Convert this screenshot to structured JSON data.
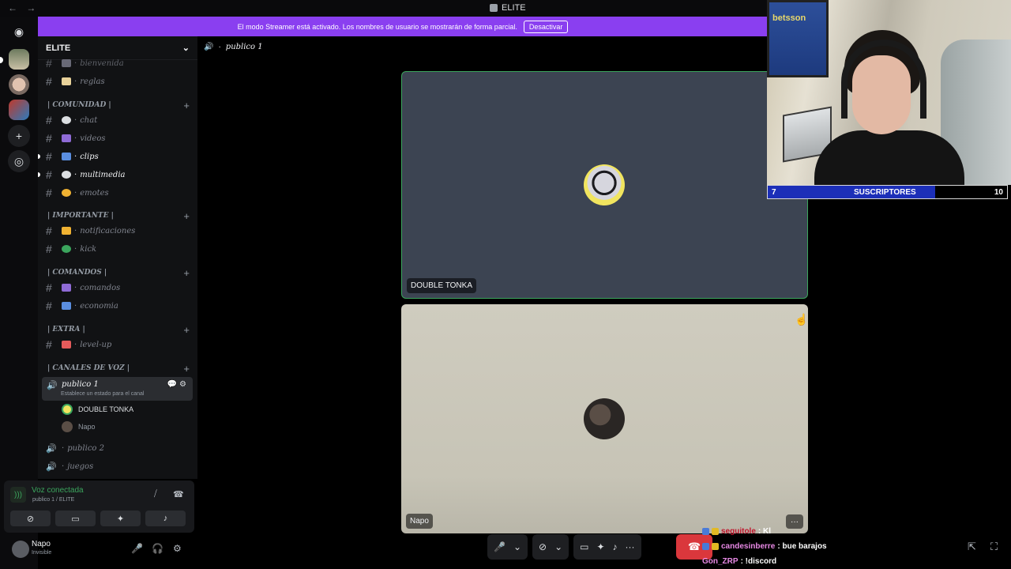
{
  "titlebar": {
    "title": "ELITE",
    "back": "←",
    "forward": "→"
  },
  "banner": {
    "message": "El modo Streamer está activado. Los nombres de usuario se mostrarán de forma parcial.",
    "button": "Desactivar"
  },
  "server": {
    "name": "ELITE"
  },
  "channels": [
    {
      "label": "bienvenida",
      "emoji_color": "#8e8ea0"
    },
    {
      "label": "reglas",
      "emoji_color": "#e8d29a"
    },
    {
      "label": "chat",
      "emoji_color": "#dbdee1"
    },
    {
      "label": "videos",
      "emoji_color": "#8f6bd6"
    },
    {
      "label": "clips",
      "emoji_color": "#5a8ee0"
    },
    {
      "label": "multimedia",
      "emoji_color": "#dbdee1"
    },
    {
      "label": "emotes",
      "emoji_color": "#f0b232"
    },
    {
      "label": "notificaciones",
      "emoji_color": "#f0b232"
    },
    {
      "label": "kick",
      "emoji_color": "#3ba55d"
    },
    {
      "label": "comandos",
      "emoji_color": "#8f6bd6"
    },
    {
      "label": "economia",
      "emoji_color": "#5a8ee0"
    },
    {
      "label": "level-up",
      "emoji_color": "#e55b5b"
    }
  ],
  "categories": [
    {
      "label": "| COMUNIDAD |",
      "plus": "+"
    },
    {
      "label": "| IMPORTANTE |",
      "plus": "+"
    },
    {
      "label": "| COMANDOS |",
      "plus": "+"
    },
    {
      "label": "| EXTRA |",
      "plus": "+"
    },
    {
      "label": "| CANALES DE VOZ |",
      "plus": "+"
    }
  ],
  "voice_channels": {
    "active": {
      "label": "publico 1",
      "status": "Establece un estado para el canal",
      "members": [
        "DOUBLE TONKA",
        "Napo"
      ]
    },
    "others": [
      "publico 2",
      "juegos"
    ]
  },
  "voice_panel": {
    "connected": "Voz conectada",
    "location": "publico 1 / ELITE"
  },
  "user": {
    "name": "Napo",
    "status": "Invisible"
  },
  "call": {
    "channel": "publico 1",
    "tiles": [
      {
        "name": "DOUBLE TONKA",
        "speaking": true
      },
      {
        "name": "Napo",
        "more": "···"
      }
    ]
  },
  "overlay": {
    "sub_count": "7",
    "sub_label": "SUSCRIPTORES",
    "sub_goal": "10",
    "sub_progress": 0.7,
    "poster_text": "betsson"
  },
  "chat_overlay": [
    {
      "user": "seguitole",
      "message": ": Kl",
      "user_color": "#c0142c"
    },
    {
      "user": "candesinberre",
      "message": ": bue barajos",
      "user_color": "#e889e5"
    },
    {
      "user": "Gon_ZRP",
      "message": ": !discord",
      "user_color": "#e889e5"
    }
  ],
  "colors": {
    "accent": "#8a3ff0",
    "connected": "#3ba55d",
    "hangup": "#da373c",
    "sub_bar": "#1c2fb8"
  }
}
